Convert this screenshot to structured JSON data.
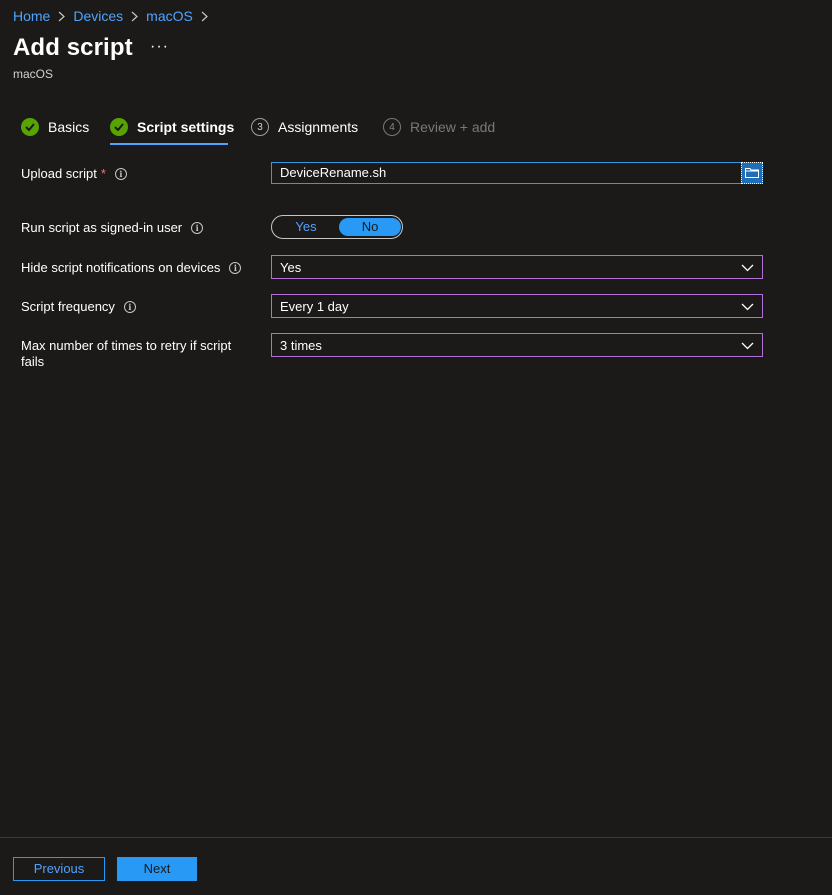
{
  "breadcrumb": [
    {
      "label": "Home"
    },
    {
      "label": "Devices"
    },
    {
      "label": "macOS"
    }
  ],
  "header": {
    "title": "Add script",
    "more": "···",
    "subtitle": "macOS"
  },
  "steps": [
    {
      "label": "Basics",
      "state": "done"
    },
    {
      "label": "Script settings",
      "state": "done-active"
    },
    {
      "label": "Assignments",
      "number": "3",
      "state": "pending"
    },
    {
      "label": "Review + add",
      "number": "4",
      "state": "disabled"
    }
  ],
  "form": {
    "upload_script": {
      "label": "Upload script",
      "required_mark": "*",
      "value": "DeviceRename.sh",
      "browse_icon": "folder-icon"
    },
    "run_as_user": {
      "label": "Run script as signed-in user",
      "yes": "Yes",
      "no": "No",
      "selected": "No"
    },
    "hide_notifications": {
      "label": "Hide script notifications on devices",
      "value": "Yes"
    },
    "frequency": {
      "label": "Script frequency",
      "value": "Every 1 day"
    },
    "max_retries": {
      "label_line1": "Max number of times to retry if script",
      "label_line2": "fails",
      "value": "3 times"
    },
    "info_glyph": "i"
  },
  "footer": {
    "previous": "Previous",
    "next": "Next"
  },
  "colors": {
    "background": "#1b1a19",
    "link": "#4fa3ff",
    "accent": "#2899f5",
    "success": "#57a300",
    "select_border": "#b06fd8"
  }
}
